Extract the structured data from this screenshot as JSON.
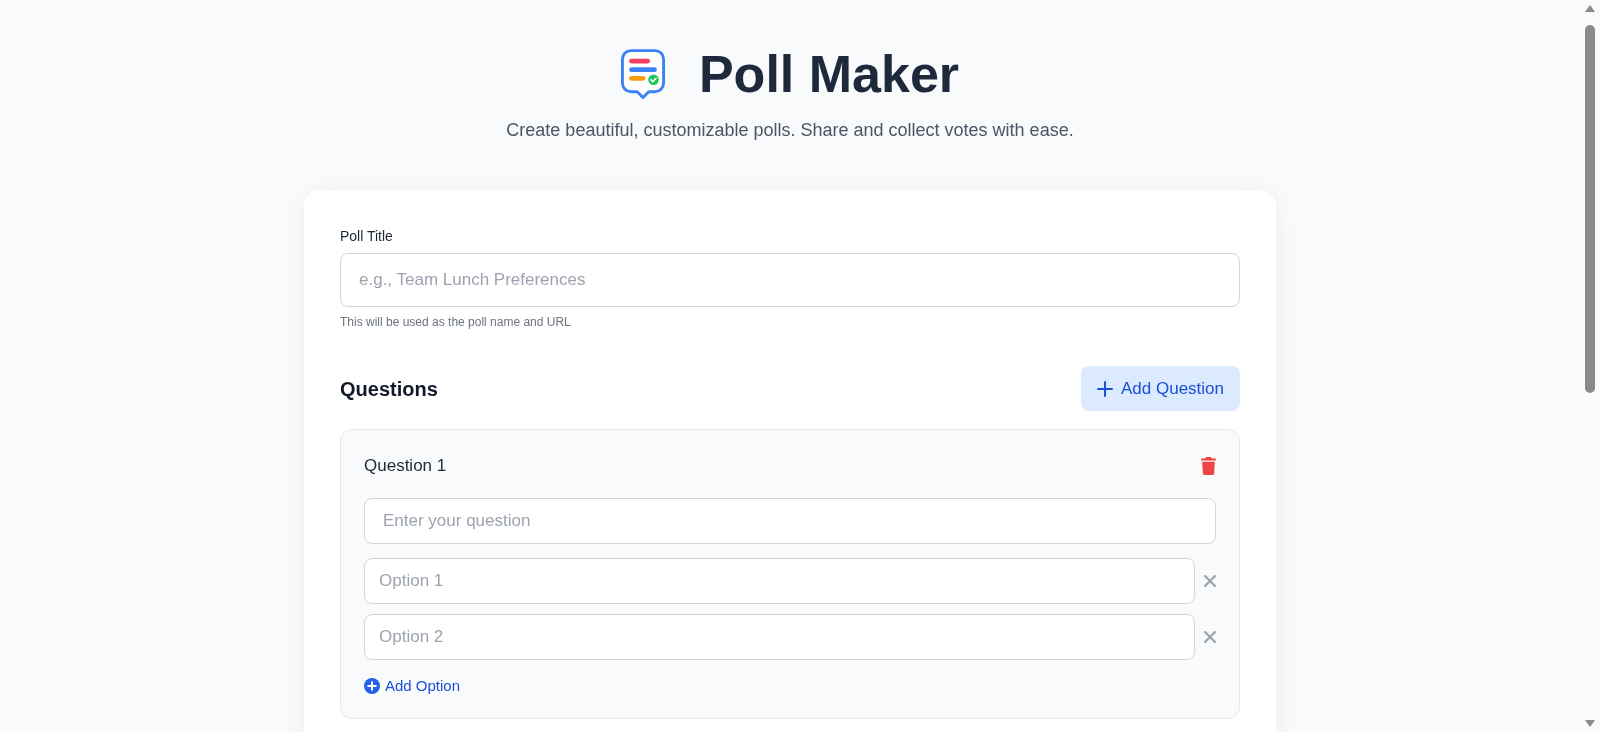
{
  "header": {
    "title": "Poll Maker",
    "subtitle": "Create beautiful, customizable polls. Share and collect votes with ease."
  },
  "poll_title": {
    "label": "Poll Title",
    "placeholder": "e.g., Team Lunch Preferences",
    "hint": "This will be used as the poll name and URL"
  },
  "questions_section": {
    "heading": "Questions",
    "add_button": "Add Question",
    "questions": [
      {
        "label": "Question 1",
        "placeholder": "Enter your question",
        "options": [
          {
            "placeholder": "Option 1"
          },
          {
            "placeholder": "Option 2"
          }
        ],
        "add_option": "Add Option"
      }
    ]
  }
}
